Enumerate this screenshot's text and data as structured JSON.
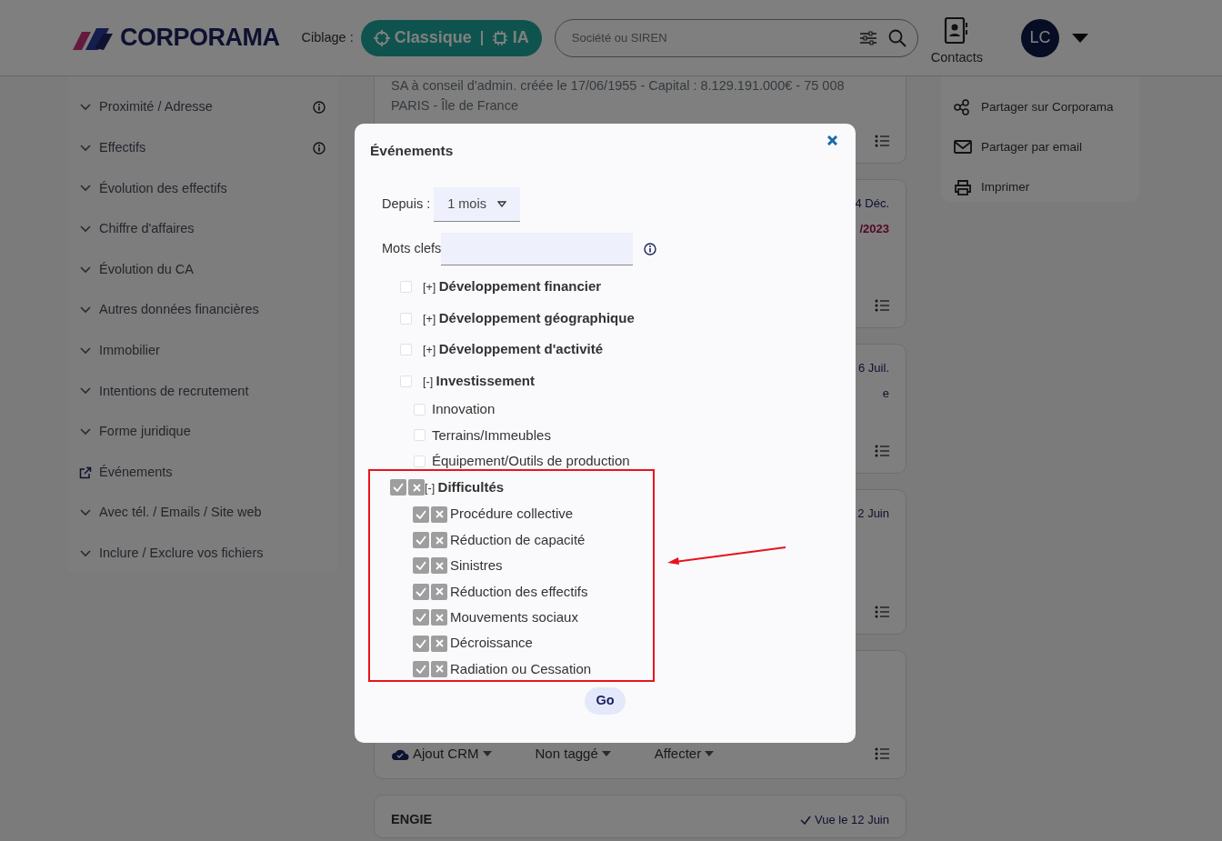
{
  "header": {
    "logo": "CORPORAMA",
    "targeting_label": "Ciblage :",
    "targeting_options": [
      {
        "label": "Classique",
        "kind": "crosshair"
      },
      {
        "label": "IA",
        "kind": "chip"
      }
    ],
    "search": {
      "placeholder": "Société ou SIREN"
    },
    "contacts_label": "Contacts",
    "avatar_initials": "LC"
  },
  "sidebar": {
    "items": [
      {
        "label": "Proximité / Adresse",
        "kind": "collapse",
        "info": true
      },
      {
        "label": "Effectifs",
        "kind": "collapse",
        "info": true
      },
      {
        "label": "Évolution des effectifs",
        "kind": "collapse",
        "info": false
      },
      {
        "label": "Chiffre d'affaires",
        "kind": "collapse",
        "info": false
      },
      {
        "label": "Évolution du CA",
        "kind": "collapse",
        "info": false
      },
      {
        "label": "Autres données financières",
        "kind": "collapse",
        "info": false
      },
      {
        "label": "Immobilier",
        "kind": "collapse",
        "info": false
      },
      {
        "label": "Intentions de recrutement",
        "kind": "collapse",
        "info": false
      },
      {
        "label": "Forme juridique",
        "kind": "collapse",
        "info": false
      },
      {
        "label": "Événements",
        "kind": "external",
        "info": false
      },
      {
        "label": "Avec tél. / Emails / Site web",
        "kind": "collapse",
        "info": false
      },
      {
        "label": "Inclure / Exclure vos fichiers",
        "kind": "collapse",
        "info": false
      }
    ]
  },
  "results": [
    {
      "lines": [
        "SA à conseil d'admin. créée le 17/06/1955 - Capital : 8.129.191.000€ - 75 008",
        "PARIS - Île de France"
      ]
    },
    {
      "date": "4 Déc.",
      "extra": "/2023"
    },
    {
      "date": "6 Juil.",
      "extra": "e"
    },
    {
      "date": "2 Juin"
    },
    {
      "actions": [
        "Ajout CRM",
        "Non taggé",
        "Affecter"
      ]
    },
    {
      "title": "ENGIE",
      "seen": "Vue le 12 Juin"
    }
  ],
  "share_panel": [
    {
      "label": "Partager sur Corporama",
      "kind": "share"
    },
    {
      "label": "Partager par email",
      "kind": "email"
    },
    {
      "label": "Imprimer",
      "kind": "print"
    }
  ],
  "modal": {
    "title": "Événements",
    "since_label": "Depuis :",
    "since_value": "1 mois",
    "keywords_label": "Mots clefs",
    "groups": [
      {
        "marker": "[+]",
        "label": "Développement financier",
        "kind": "checkbox",
        "checked": false
      },
      {
        "marker": "[+]",
        "label": "Développement géographique",
        "kind": "checkbox",
        "checked": false
      },
      {
        "marker": "[+]",
        "label": "Développement d'activité",
        "kind": "checkbox",
        "checked": false
      },
      {
        "marker": "[-]",
        "label": "Investissement",
        "kind": "checkbox",
        "checked": false,
        "children": [
          {
            "label": "Innovation",
            "checked": false
          },
          {
            "label": "Terrains/Immeubles",
            "checked": false
          },
          {
            "label": "Équipement/Outils de production",
            "checked": false
          }
        ]
      },
      {
        "marker": "[-]",
        "label": "Difficultés",
        "kind": "include-exclude",
        "include": false,
        "exclude": false,
        "children": [
          {
            "label": "Procédure collective",
            "include": false,
            "exclude": false
          },
          {
            "label": "Réduction de capacité",
            "include": false,
            "exclude": false
          },
          {
            "label": "Sinistres",
            "include": false,
            "exclude": false
          },
          {
            "label": "Réduction des effectifs",
            "include": false,
            "exclude": false
          },
          {
            "label": "Mouvements sociaux",
            "include": false,
            "exclude": false
          },
          {
            "label": "Décroissance",
            "include": false,
            "exclude": false
          },
          {
            "label": "Radiation ou Cessation",
            "include": false,
            "exclude": false
          }
        ]
      }
    ],
    "go_label": "Go"
  }
}
